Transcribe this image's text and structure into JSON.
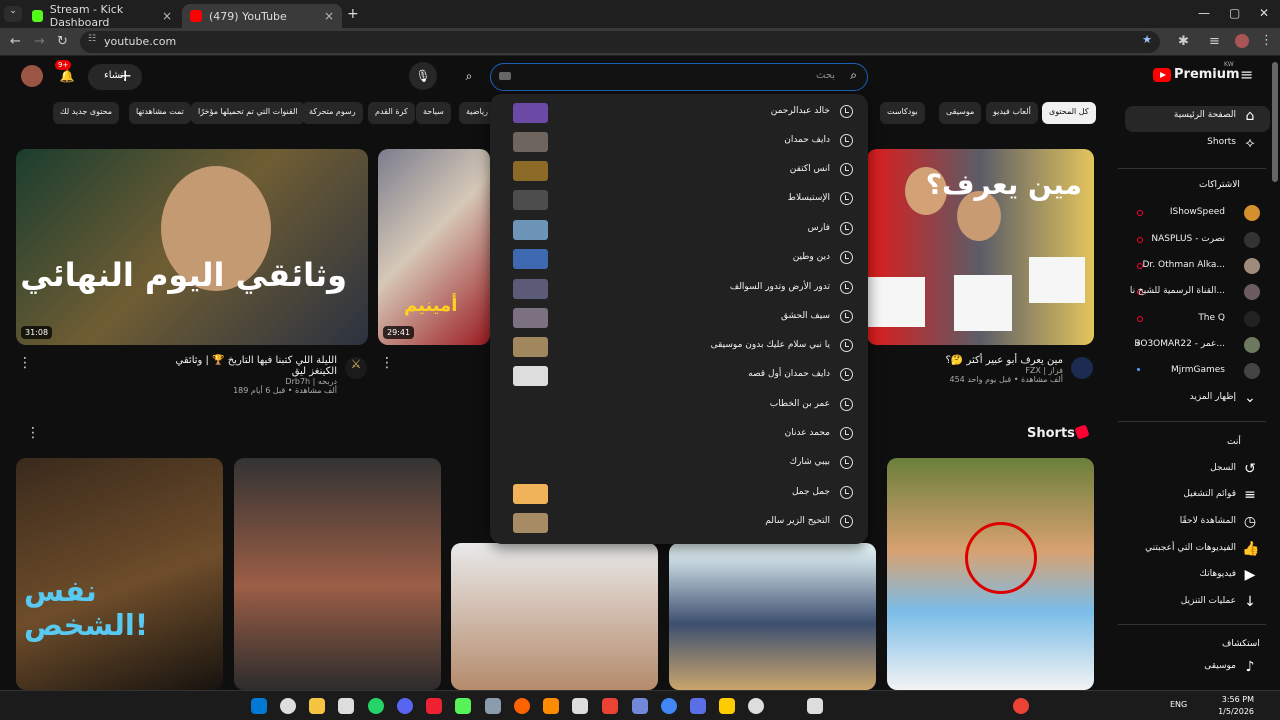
{
  "browser": {
    "tabs": [
      {
        "title": "Stream - Kick Dashboard",
        "color": "#53fc18"
      },
      {
        "title": "(479) YouTube",
        "color": "#ff0000"
      }
    ],
    "url": "youtube.com",
    "new_tab": "+",
    "close": "×"
  },
  "header": {
    "create_label": "إنشاء",
    "notification_count": "9+",
    "search_placeholder": "بحث",
    "brand": "Premium",
    "region": "KW"
  },
  "chips": [
    "كل المحتوى",
    "ألعاب فيديو",
    "موسيقى",
    "بودكاست",
    "رياضية",
    "سياحة",
    "كرة القدم",
    "رسوم متحركة",
    "القنوات التي تم تحميلها مؤخرًا",
    "تمت مشاهدتها",
    "محتوى جديد لك"
  ],
  "suggestions": [
    {
      "text": "خالد عبدالرحمن",
      "thumb": "#6a4aa5"
    },
    {
      "text": "دايف حمدان",
      "thumb": "#6e655e"
    },
    {
      "text": "انس اكتفن",
      "thumb": "#8c6b29"
    },
    {
      "text": "الإستبسلاط",
      "thumb": "#4d4d4d"
    },
    {
      "text": "فارس",
      "thumb": "#6d95b8"
    },
    {
      "text": "دين وطين",
      "thumb": "#3e69b0"
    },
    {
      "text": "تدور الأرض وتدور السوالف",
      "thumb": "#5b5b78"
    },
    {
      "text": "سيف الحشق",
      "thumb": "#7b7180"
    },
    {
      "text": "يا نبي سلام عليك بدون موسيقى",
      "thumb": "#a0875d"
    },
    {
      "text": "دايف حمدان أول قصه",
      "thumb": "#ddd"
    },
    {
      "text": "عمر بن الخطاب",
      "thumb": ""
    },
    {
      "text": "محمد عدنان",
      "thumb": ""
    },
    {
      "text": "بيبي شارك",
      "thumb": ""
    },
    {
      "text": "جمل جمل",
      "thumb": "#f1b35a"
    },
    {
      "text": "التحيح الزير سالم",
      "thumb": "#a68b64"
    }
  ],
  "videos": [
    {
      "title": "الليلة اللي كتبنا فيها التاريخ 🏆 | وثائقي الكينغز ليق",
      "channel": "Drb7h | دربحه",
      "stats": "189 ألف مشاهدة • قبل 6 أيام",
      "duration": "31:08",
      "overlay": "وثائقي اليوم النهائي"
    },
    {
      "title": "",
      "channel": "",
      "stats": "",
      "duration": "29:41",
      "overlay": "أمينيم"
    },
    {
      "title": "مين يعرف أبو عبير أكثر 🤔؟",
      "channel": "FZX | فزاز",
      "stats": "454 ألف مشاهدة • قبل يوم واحد",
      "duration": "",
      "overlay": "مين يعرف؟"
    }
  ],
  "shorts": {
    "title": "Shorts",
    "overlay": "نفس الشخص!"
  },
  "sidebar": {
    "main": [
      {
        "label": "الصفحة الرئيسية",
        "icon": "home-icon"
      },
      {
        "label": "Shorts",
        "icon": "shorts-icon"
      }
    ],
    "subscriptions_title": "الاشتراكات",
    "subscriptions": [
      {
        "label": "IShowSpeed",
        "color": "#d48f2e"
      },
      {
        "label": "NASPLUS - نصرت",
        "color": "#333"
      },
      {
        "label": "Dr. Othman Alka...",
        "color": "#9f8b7b"
      },
      {
        "label": "القناة الرسمية للشيخ نا...",
        "color": "#6c5b5e"
      },
      {
        "label": "The Q",
        "color": "#222"
      },
      {
        "label": "BO3OMAR22 - عمر...",
        "color": "#6d7a5f"
      },
      {
        "label": "MjrmGames",
        "color": "#444"
      }
    ],
    "show_more": "إظهار المزيد",
    "you_title": "أنت",
    "you": [
      {
        "label": "السجل",
        "icon": "history-icon"
      },
      {
        "label": "قوائم التشغيل",
        "icon": "playlist-icon"
      },
      {
        "label": "المشاهدة لاحقًا",
        "icon": "watch-later-icon"
      },
      {
        "label": "الفيديوهات التي أعجبتني",
        "icon": "like-icon"
      },
      {
        "label": "فيديوهاتك",
        "icon": "your-videos-icon"
      },
      {
        "label": "عمليات التنزيل",
        "icon": "download-icon"
      }
    ],
    "explore_title": "استكشاف",
    "explore": [
      {
        "label": "موسيقى",
        "icon": "music-icon"
      }
    ]
  },
  "taskbar": {
    "lang": "ENG",
    "time": "3:56 PM",
    "date": "1/5/2026",
    "icons": [
      "#0078d4",
      "#ddd",
      "#f5c542",
      "#ddd",
      "#25d366",
      "#5865f2",
      "#e23",
      "#57f257",
      "#8b9cad",
      "#ff6200",
      "#ff8c00",
      "#ddd",
      "#ea4335",
      "#7289da",
      "#ffcc00",
      "#ddd",
      "#ddd",
      "#ddd",
      "#ddd",
      "#fff",
      "#ddd",
      "#ddd"
    ]
  }
}
